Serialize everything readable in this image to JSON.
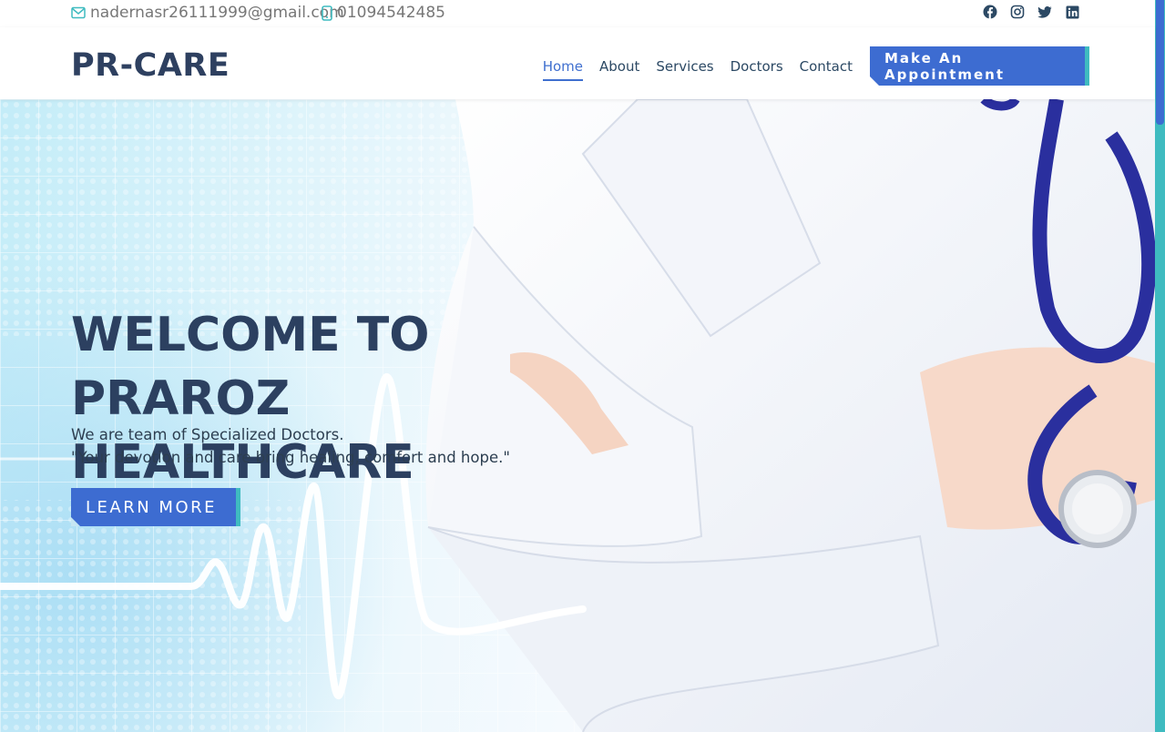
{
  "topbar": {
    "email": "nadernasr26111999@gmail.com",
    "phone": "01094542485",
    "socials": [
      "facebook-icon",
      "instagram-icon",
      "twitter-icon",
      "linkedin-icon"
    ]
  },
  "header": {
    "logo": "PR-CARE",
    "nav": [
      "Home",
      "About",
      "Services",
      "Doctors",
      "Contact"
    ],
    "active_nav": "Home",
    "appointment_label": "Make An Appointment"
  },
  "hero": {
    "title": "WELCOME TO PRAROZ HEALTHCARE",
    "subtitle_line1": "We are team of Specialized Doctors.",
    "subtitle_line2": "\"Your devotion and care bring healing, comfort and hope.\"",
    "cta_label": "LEARN MORE"
  },
  "colors": {
    "accent": "#3d6cd1",
    "secondary": "#3fbbc0",
    "heading": "#2c4060",
    "muted": "#777777"
  }
}
